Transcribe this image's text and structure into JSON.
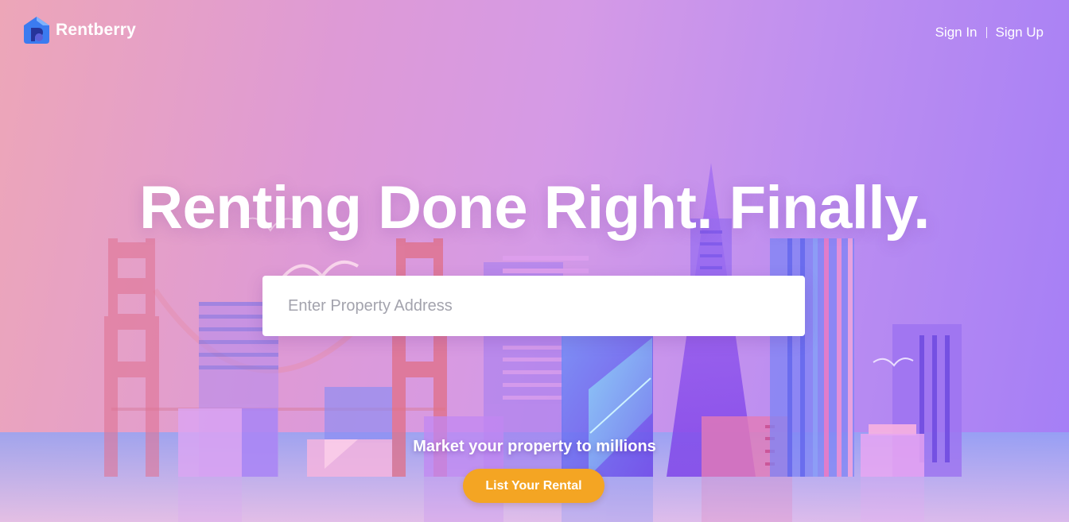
{
  "header": {
    "brand": "Rentberry",
    "sign_in": "Sign In",
    "sign_up": "Sign Up"
  },
  "hero": {
    "headline": "Renting Done Right. Finally.",
    "search_placeholder": "Enter Property Address",
    "tagline": "Market your property to millions",
    "cta_label": "List Your Rental"
  },
  "colors": {
    "cta": "#f4a523",
    "logo": "#3b7bf0",
    "gradient_start": "#eda6b8",
    "gradient_end": "#a47ef6"
  }
}
